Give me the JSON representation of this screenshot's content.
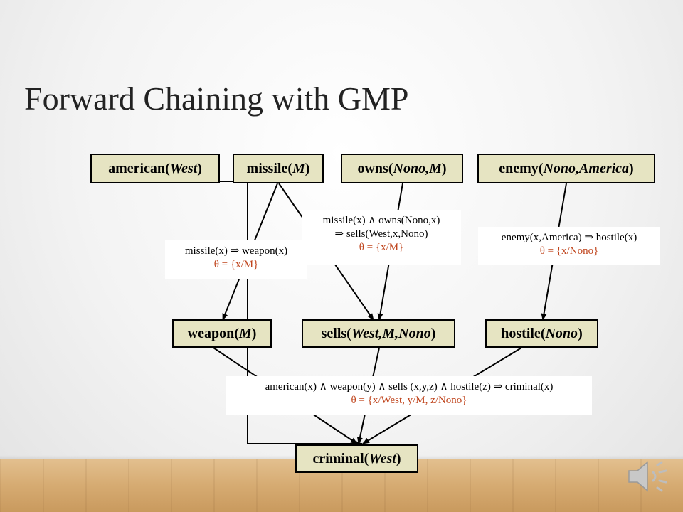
{
  "slide": {
    "title": "Forward Chaining with GMP"
  },
  "nodes": {
    "american": {
      "pred": "american",
      "args": "West"
    },
    "missile": {
      "pred": "missile",
      "args": "M"
    },
    "owns": {
      "pred": "owns",
      "args": "Nono,M"
    },
    "enemy": {
      "pred": "enemy",
      "args": "Nono,America"
    },
    "weapon": {
      "pred": "weapon",
      "args": "M"
    },
    "sells": {
      "pred": "sells",
      "args": "West,M,Nono"
    },
    "hostile": {
      "pred": "hostile",
      "args": "Nono"
    },
    "criminal": {
      "pred": "criminal",
      "args": "West"
    }
  },
  "rules": {
    "weapon_rule": {
      "text": "missile(x) ⇒ weapon(x)",
      "theta": "θ = {x/M}"
    },
    "sells_rule": {
      "line1": "missile(x) ∧ owns(Nono,x)",
      "line2": "⇒ sells(West,x,Nono)",
      "theta": "θ = {x/M}"
    },
    "hostile_rule": {
      "text": "enemy(x,America) ⇒ hostile(x)",
      "theta": "θ = {x/Nono}"
    },
    "criminal_rule": {
      "text": "american(x) ∧ weapon(y) ∧ sells (x,y,z) ∧ hostile(z) ⇒ criminal(x)",
      "theta": "θ = {x/West, y/M, z/Nono}"
    }
  },
  "icons": {
    "audio": "speaker-icon"
  }
}
